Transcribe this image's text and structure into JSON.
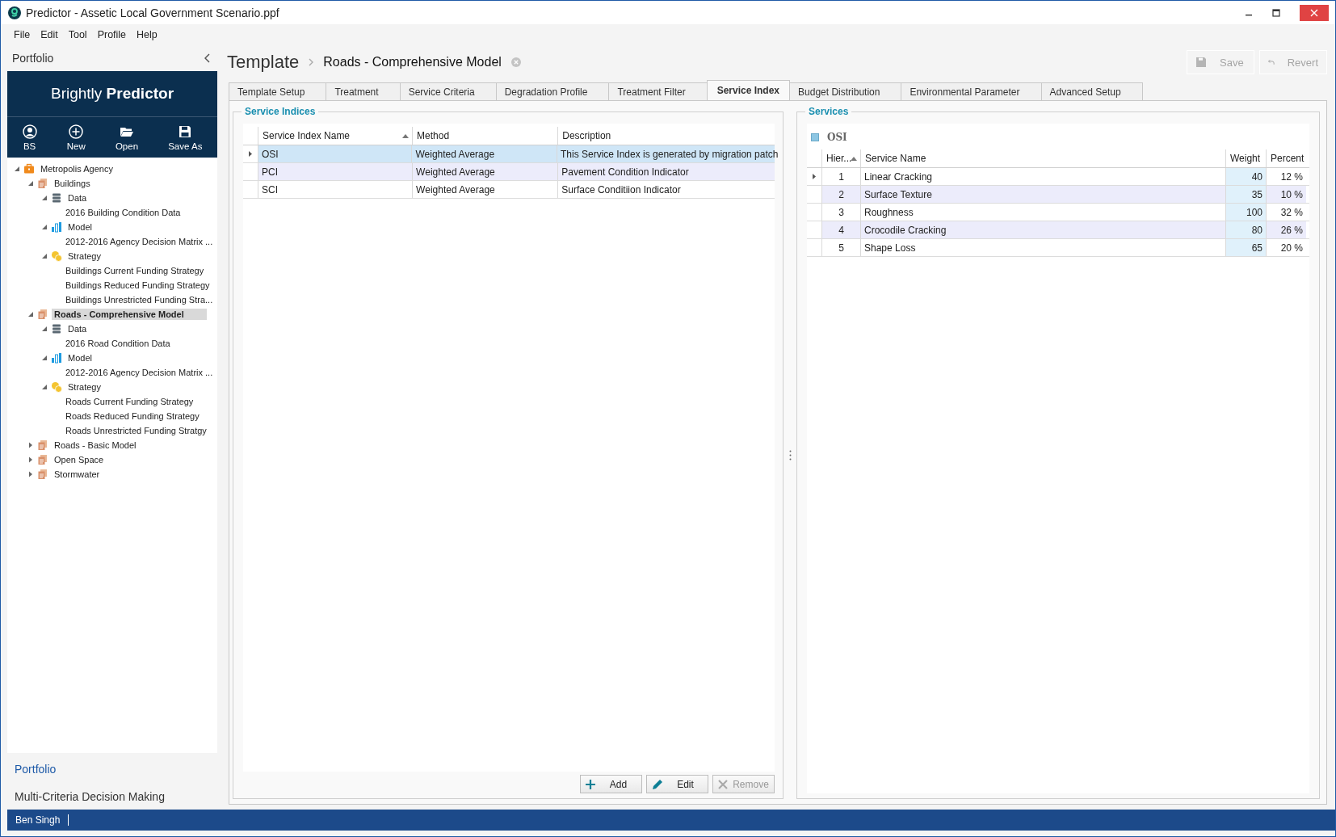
{
  "window": {
    "title": "Predictor - Assetic Local Government Scenario.ppf"
  },
  "menu": [
    "File",
    "Edit",
    "Tool",
    "Profile",
    "Help"
  ],
  "sidebar": {
    "title": "Portfolio",
    "brand": "Brightly **Predictor**",
    "toolbar": [
      {
        "label": "BS",
        "kind": "user"
      },
      {
        "label": "New",
        "kind": "new"
      },
      {
        "label": "Open",
        "kind": "open"
      },
      {
        "label": "Save As",
        "kind": "save"
      }
    ],
    "tree": [
      {
        "label": "Metropolis Agency",
        "kind": "agency",
        "expanded": true,
        "selected": false,
        "children": [
          {
            "label": "Buildings",
            "kind": "project",
            "expanded": true,
            "selected": false,
            "children": [
              {
                "label": "Data",
                "kind": "data",
                "expanded": true,
                "selected": false,
                "children": [
                  {
                    "label": "2016 Building Condition Data",
                    "kind": "leaf",
                    "selected": false
                  }
                ]
              },
              {
                "label": "Model",
                "kind": "model",
                "expanded": true,
                "selected": false,
                "children": [
                  {
                    "label": "2012-2016 Agency Decision Matrix ...",
                    "kind": "leaf",
                    "selected": false
                  }
                ]
              },
              {
                "label": "Strategy",
                "kind": "strategy",
                "expanded": true,
                "selected": false,
                "children": [
                  {
                    "label": "Buildings Current Funding Strategy",
                    "kind": "leaf",
                    "selected": false
                  },
                  {
                    "label": "Buildings Reduced Funding Strategy",
                    "kind": "leaf",
                    "selected": false
                  },
                  {
                    "label": "Buildings Unrestricted Funding Stra...",
                    "kind": "leaf",
                    "selected": false
                  }
                ]
              }
            ]
          },
          {
            "label": "Roads - Comprehensive Model",
            "kind": "project",
            "expanded": true,
            "selected": true,
            "children": [
              {
                "label": "Data",
                "kind": "data",
                "expanded": true,
                "selected": false,
                "children": [
                  {
                    "label": "2016 Road Condition Data",
                    "kind": "leaf",
                    "selected": false
                  }
                ]
              },
              {
                "label": "Model",
                "kind": "model",
                "expanded": true,
                "selected": false,
                "children": [
                  {
                    "label": "2012-2016 Agency Decision Matrix ...",
                    "kind": "leaf",
                    "selected": false
                  }
                ]
              },
              {
                "label": "Strategy",
                "kind": "strategy",
                "expanded": true,
                "selected": false,
                "children": [
                  {
                    "label": "Roads Current Funding Strategy",
                    "kind": "leaf",
                    "selected": false
                  },
                  {
                    "label": "Roads Reduced Funding Strategy",
                    "kind": "leaf",
                    "selected": false
                  },
                  {
                    "label": "Roads Unrestricted Funding Stratgy",
                    "kind": "leaf",
                    "selected": false
                  }
                ]
              }
            ]
          },
          {
            "label": "Roads - Basic Model",
            "kind": "project",
            "expanded": false,
            "selected": false
          },
          {
            "label": "Open Space",
            "kind": "project",
            "expanded": false,
            "selected": false
          },
          {
            "label": "Stormwater",
            "kind": "project",
            "expanded": false,
            "selected": false
          }
        ]
      }
    ],
    "nav_links": [
      {
        "label": "Portfolio",
        "selected": true
      },
      {
        "label": "Multi-Criteria Decision Making",
        "selected": false
      }
    ]
  },
  "header": {
    "section": "Template",
    "name": "Roads - Comprehensive Model",
    "actions": [
      {
        "label": "Save",
        "kind": "save",
        "disabled": true
      },
      {
        "label": "Revert",
        "kind": "revert",
        "disabled": true
      }
    ]
  },
  "tabs": [
    {
      "label": "Template Setup",
      "selected": false
    },
    {
      "label": "Treatment",
      "selected": false
    },
    {
      "label": "Service Criteria",
      "selected": false
    },
    {
      "label": "Degradation Profile",
      "selected": false
    },
    {
      "label": "Treatment Filter",
      "selected": false
    },
    {
      "label": "Service Index",
      "selected": true
    },
    {
      "label": "Budget Distribution",
      "selected": false
    },
    {
      "label": "Environmental Parameter",
      "selected": false
    },
    {
      "label": "Advanced Setup",
      "selected": false
    }
  ],
  "service_indices": {
    "title": "Service Indices",
    "columns": [
      {
        "label": "Service Index Name",
        "sorted": true
      },
      {
        "label": "Method",
        "sorted": false
      },
      {
        "label": "Description",
        "sorted": false
      }
    ],
    "rows": [
      {
        "cells": [
          "OSI",
          "Weighted Average",
          "This Service Index is generated by migration patch"
        ],
        "selected": true,
        "focused": true
      },
      {
        "cells": [
          "PCI",
          "Weighted Average",
          "Pavement Condition Indicator"
        ],
        "selected": false,
        "focused": false
      },
      {
        "cells": [
          "SCI",
          "Weighted Average",
          "Surface Conditiion Indicator"
        ],
        "selected": false,
        "focused": false
      }
    ],
    "buttons": [
      {
        "label": "Add",
        "kind": "add",
        "disabled": false
      },
      {
        "label": "Edit",
        "kind": "edit",
        "disabled": false
      },
      {
        "label": "Remove",
        "kind": "remove",
        "disabled": true
      }
    ]
  },
  "services": {
    "title": "Services",
    "index": "OSI",
    "columns": [
      {
        "label": "Hier...",
        "sorted": true
      },
      {
        "label": "Service Name",
        "sorted": false
      },
      {
        "label": "Weight",
        "sorted": false
      },
      {
        "label": "Percent",
        "sorted": false
      }
    ],
    "rows": [
      {
        "cells": [
          "1",
          "Linear Cracking",
          "40",
          "12 %"
        ],
        "focused": true
      },
      {
        "cells": [
          "2",
          "Surface Texture",
          "35",
          "10 %"
        ],
        "focused": false
      },
      {
        "cells": [
          "3",
          "Roughness",
          "100",
          "32 %"
        ],
        "focused": false
      },
      {
        "cells": [
          "4",
          "Crocodile Cracking",
          "80",
          "26 %"
        ],
        "focused": false
      },
      {
        "cells": [
          "5",
          "Shape Loss",
          "65",
          "20 %"
        ],
        "focused": false
      }
    ]
  },
  "status_bar": {
    "user": "Ben Singh"
  }
}
